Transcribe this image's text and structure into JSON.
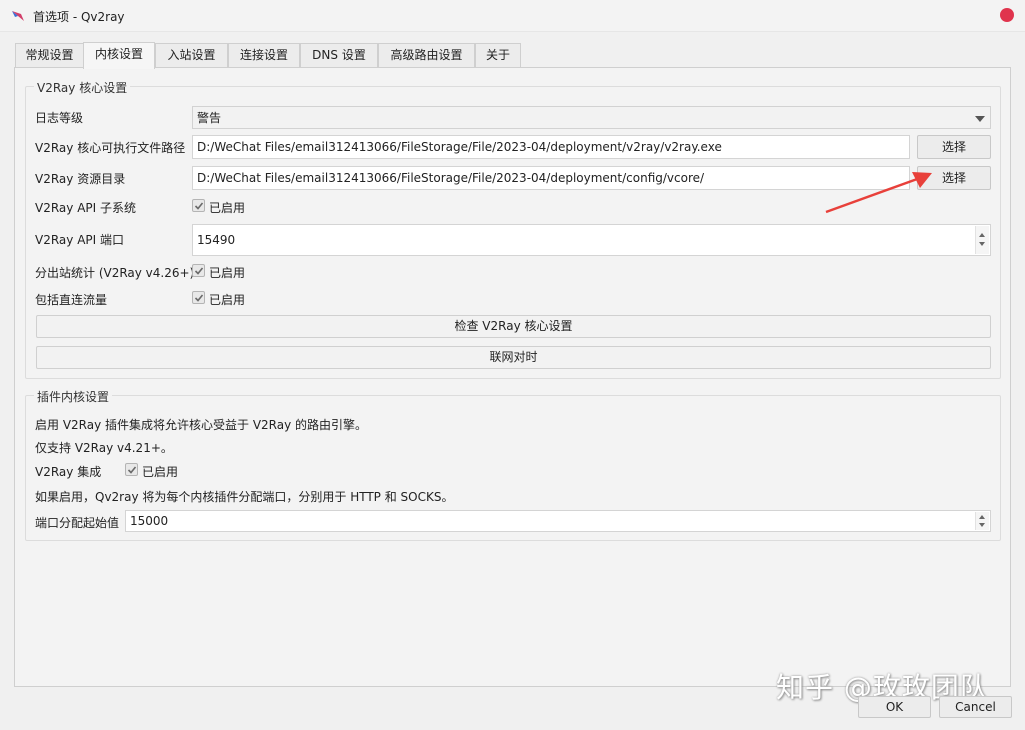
{
  "window": {
    "title": "首选项 - Qv2ray"
  },
  "tabs": [
    {
      "label": "常规设置"
    },
    {
      "label": "内核设置"
    },
    {
      "label": "入站设置"
    },
    {
      "label": "连接设置"
    },
    {
      "label": "DNS 设置"
    },
    {
      "label": "高级路由设置"
    },
    {
      "label": "关于"
    }
  ],
  "core": {
    "group_title": "V2Ray 核心设置",
    "log_level_label": "日志等级",
    "log_level_value": "警告",
    "exe_path_label": "V2Ray 核心可执行文件路径",
    "exe_path_value": "D:/WeChat Files/email312413066/FileStorage/File/2023-04/deployment/v2ray/v2ray.exe",
    "exe_browse": "选择",
    "assets_label": "V2Ray 资源目录",
    "assets_value": "D:/WeChat Files/email312413066/FileStorage/File/2023-04/deployment/config/vcore/",
    "assets_browse": "选择",
    "api_label": "V2Ray API 子系统",
    "api_check": "已启用",
    "api_port_label": "V2Ray API 端口",
    "api_port_value": "15490",
    "outbound_stats_label": "分出站统计 (V2Ray v4.26+)",
    "outbound_stats_check": "已启用",
    "direct_label": "包括直连流量",
    "direct_check": "已启用",
    "check_button": "检查 V2Ray 核心设置",
    "sync_button": "联网对时"
  },
  "plugin": {
    "group_title": "插件内核设置",
    "desc1": "启用 V2Ray 插件集成将允许核心受益于 V2Ray 的路由引擎。",
    "desc2": "仅支持 V2Ray v4.21+。",
    "integration_label": "V2Ray 集成",
    "integration_check": "已启用",
    "desc3": "如果启用，Qv2ray 将为每个内核插件分配端口，分别用于 HTTP 和 SOCKS。",
    "port_start_label": "端口分配起始值",
    "port_start_value": "15000"
  },
  "footer": {
    "ok": "OK",
    "cancel": "Cancel",
    "watermark": "知乎 @玫玫团队"
  },
  "colors": {
    "accent_close": "#e0344d",
    "annotation_arrow": "#e8403a"
  }
}
